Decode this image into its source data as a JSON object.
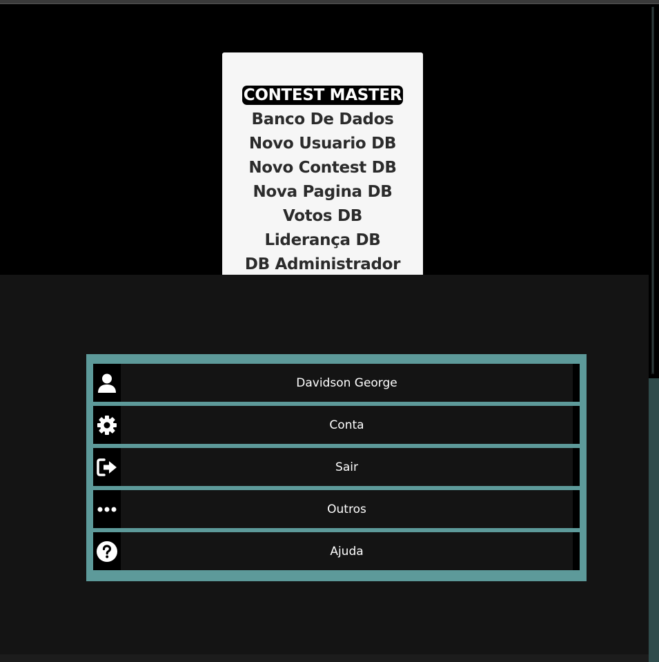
{
  "menu": {
    "items": [
      {
        "label": "CONTEST MASTER",
        "active": true
      },
      {
        "label": "Banco De Dados"
      },
      {
        "label": "Novo Usuario DB"
      },
      {
        "label": "Novo Contest DB"
      },
      {
        "label": "Nova Pagina DB"
      },
      {
        "label": "Votos DB"
      },
      {
        "label": "Liderança DB"
      },
      {
        "label": "DB Administrador"
      }
    ]
  },
  "profile_menu": {
    "items": [
      {
        "label": "Davidson George",
        "icon": "user-icon"
      },
      {
        "label": "Conta",
        "icon": "gear-icon"
      },
      {
        "label": "Sair",
        "icon": "logout-icon"
      },
      {
        "label": "Outros",
        "icon": "ellipsis-icon"
      },
      {
        "label": "Ajuda",
        "icon": "help-icon"
      }
    ]
  },
  "colors": {
    "panel_border": "#5d9a9a",
    "row_background": "#141414",
    "menu_card": "#f6f6f6",
    "menu_text": "#2b2b2b",
    "overlay": "#141414"
  }
}
